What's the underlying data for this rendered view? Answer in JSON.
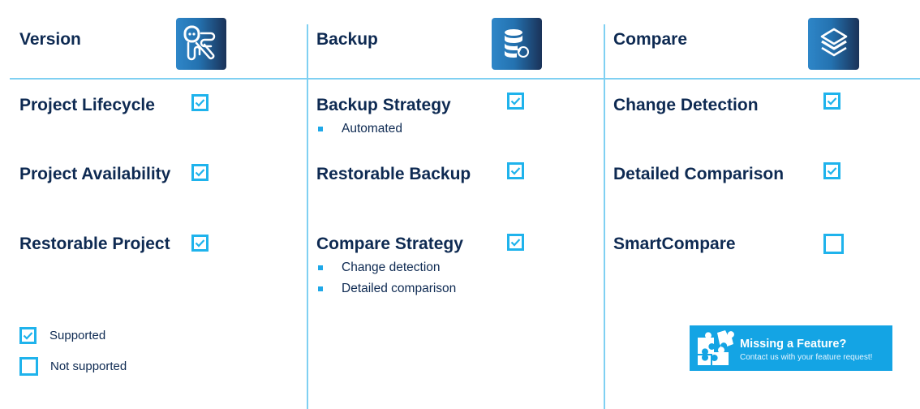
{
  "colors": {
    "accent": "#1fb3ec",
    "text": "#0e2a52",
    "divider": "#7fd0f2",
    "banner": "#14a4e4"
  },
  "columns": [
    {
      "title": "Version",
      "icon": "octopus-mascot-icon",
      "features": [
        {
          "label": "Project Lifecycle",
          "supported": true,
          "bullets": []
        },
        {
          "label": "Project Availability",
          "supported": true,
          "bullets": []
        },
        {
          "label": "Restorable Project",
          "supported": true,
          "bullets": []
        }
      ]
    },
    {
      "title": "Backup",
      "icon": "database-restore-icon",
      "features": [
        {
          "label": "Backup Strategy",
          "supported": true,
          "bullets": [
            "Automated"
          ]
        },
        {
          "label": "Restorable Backup",
          "supported": true,
          "bullets": []
        },
        {
          "label": "Compare Strategy",
          "supported": true,
          "bullets": [
            "Change detection",
            "Detailed comparison"
          ]
        }
      ]
    },
    {
      "title": "Compare",
      "icon": "layers-icon",
      "features": [
        {
          "label": "Change Detection",
          "supported": true,
          "bullets": []
        },
        {
          "label": "Detailed Comparison",
          "supported": true,
          "bullets": []
        },
        {
          "label": "SmartCompare",
          "supported": false,
          "bullets": []
        }
      ]
    }
  ],
  "legend": {
    "supported": "Supported",
    "not_supported": "Not supported"
  },
  "banner": {
    "icon": "puzzle-pieces-icon",
    "title": "Missing a Feature?",
    "subtitle": "Contact us with your feature request!"
  }
}
